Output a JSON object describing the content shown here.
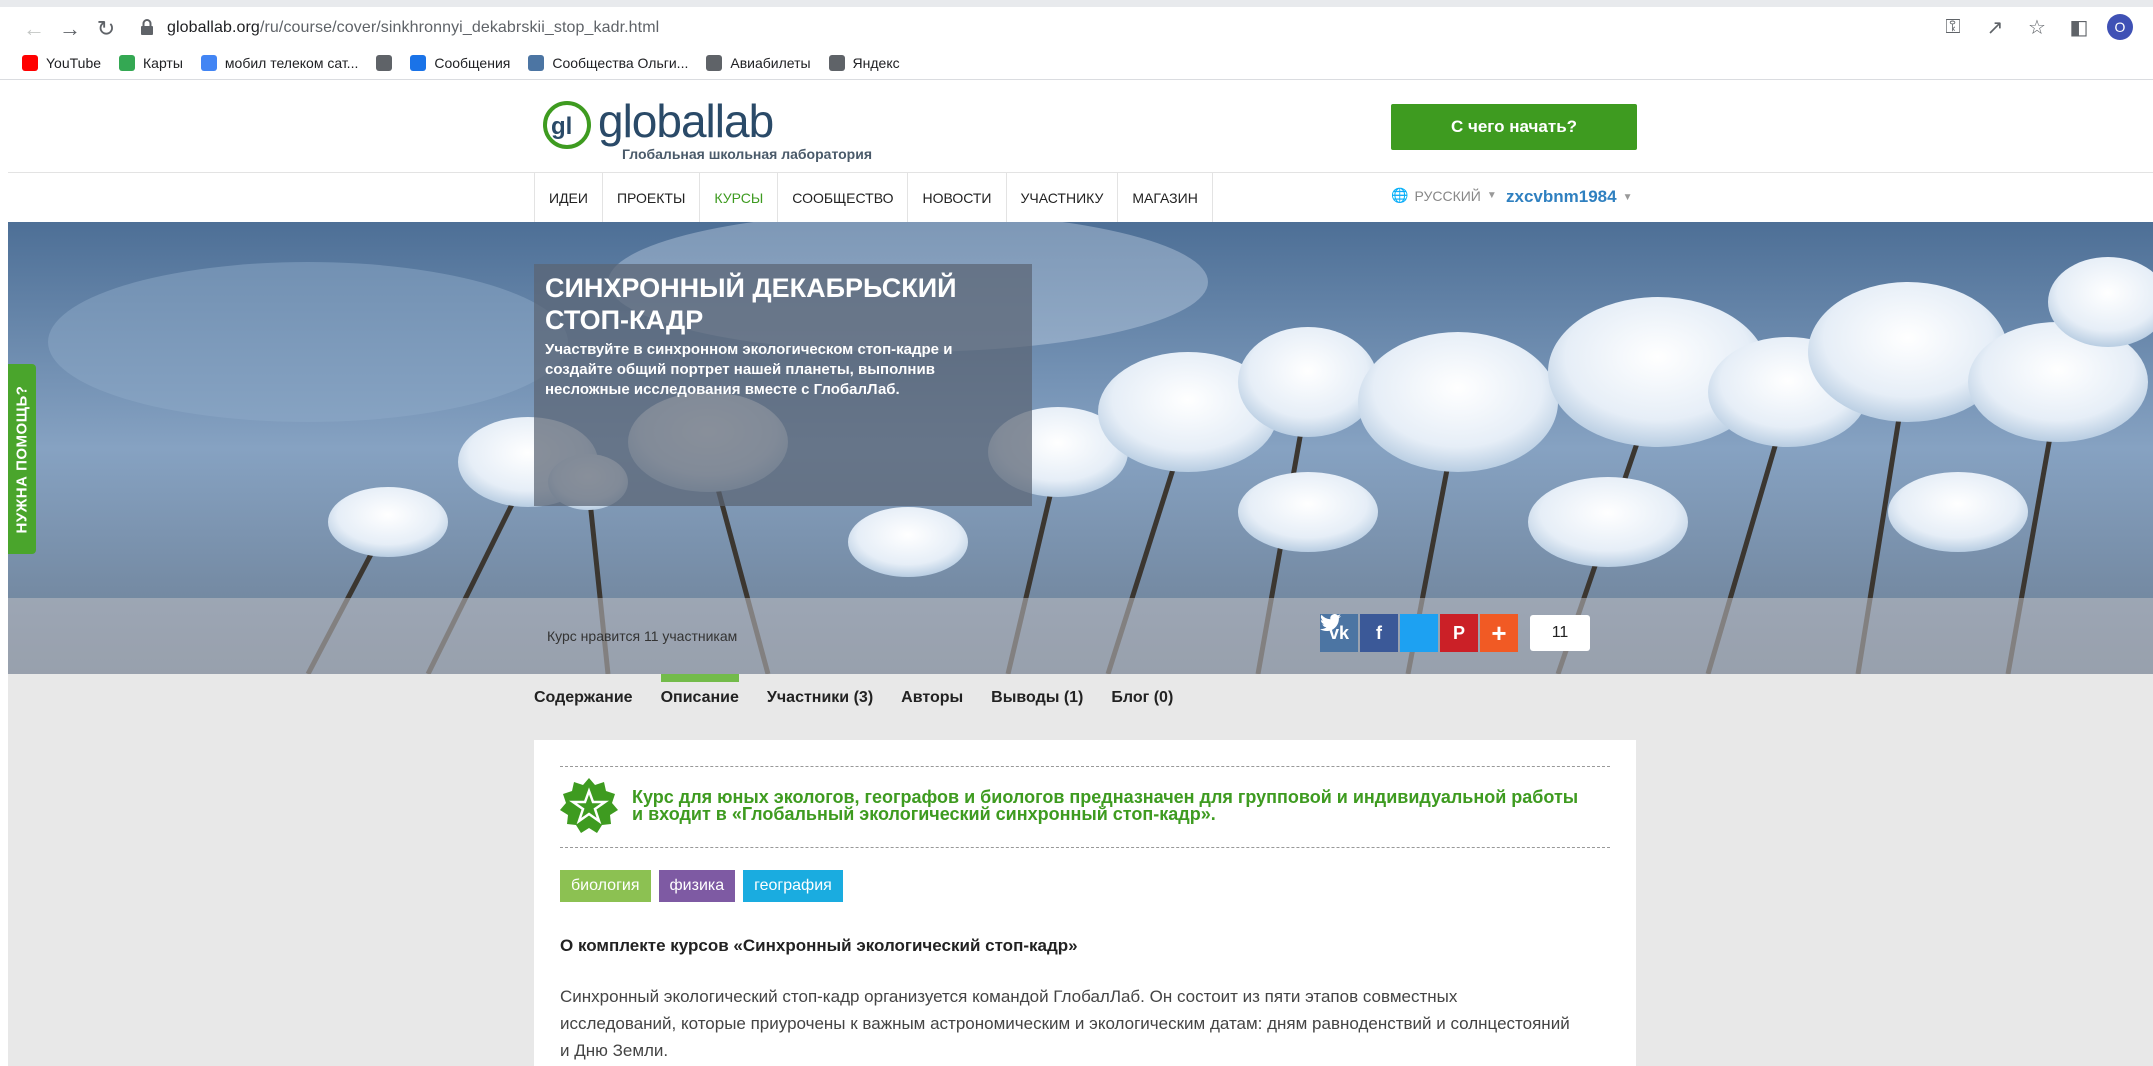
{
  "browser": {
    "url_host": "globallab.org",
    "url_path": "/ru/course/cover/sinkhronnyi_dekabrskii_stop_kadr.html",
    "profile_initial": "O"
  },
  "bookmarks": [
    {
      "label": "YouTube",
      "icon": "youtube-icon",
      "color": "#ff0000"
    },
    {
      "label": "Карты",
      "icon": "maps-icon",
      "color": "#34a853"
    },
    {
      "label": "мобил телеком сат...",
      "icon": "google-icon",
      "color": "#4285f4"
    },
    {
      "label": "",
      "icon": "globe-icon",
      "color": "#5f6368"
    },
    {
      "label": "Сообщения",
      "icon": "messages-icon",
      "color": "#1a73e8"
    },
    {
      "label": "Сообщества Ольги...",
      "icon": "vk-icon",
      "color": "#4c75a3"
    },
    {
      "label": "Авиабилеты",
      "icon": "globe-icon",
      "color": "#5f6368"
    },
    {
      "label": "Яндекс",
      "icon": "globe-icon",
      "color": "#5f6368"
    }
  ],
  "header": {
    "logo_word": "globallab",
    "logo_sub": "Глобальная школьная лаборатория",
    "cta_label": "С чего начать?"
  },
  "nav": {
    "items": [
      "Идеи",
      "Проекты",
      "Курсы",
      "Сообщество",
      "Новости",
      "Участнику",
      "Магазин"
    ],
    "active_index": 2,
    "language": "РУССКИЙ",
    "username": "zxcvbnm1984"
  },
  "help_tab": "НУЖНА ПОМОЩЬ?",
  "hero": {
    "title": "Синхронный декабрьский стоп-кадр",
    "description": "Участвуйте в синхронном экологическом стоп-кадре и создайте общий портрет нашей планеты, выполнив несложные исследования вместе с ГлобалЛаб.",
    "likes_text": "Курс нравится 11 участникам",
    "share_count": "11"
  },
  "tabs": {
    "items": [
      "Содержание",
      "Описание",
      "Участники (3)",
      "Авторы",
      "Выводы (1)",
      "Блог (0)"
    ],
    "active_index": 1
  },
  "course": {
    "intro": "Курс для юных экологов, географов и биологов предназначен для групповой и индивидуальной работы и входит в «Глобальный экологический синхронный стоп-кадр».",
    "tags": [
      "биология",
      "физика",
      "география"
    ],
    "section_title": "О комплекте курсов «Синхронный экологический стоп-кадр»",
    "section_body": "Синхронный экологический стоп-кадр организуется командой ГлобалЛаб. Он состоит из пяти этапов совместных исследований, которые приурочены к важным астрономическим и экологическим датам: дням равноденствий и солнцестояний и Дню Земли."
  },
  "colors": {
    "brand_green": "#3e9b20",
    "link_blue": "#2f80c0"
  }
}
